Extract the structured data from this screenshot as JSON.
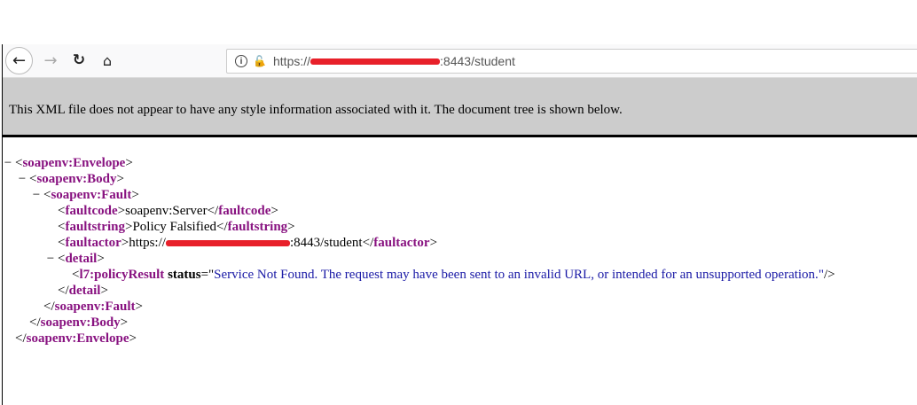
{
  "browser": {
    "url_prefix": "https://",
    "url_suffix": ":8443/student"
  },
  "banner": "This XML file does not appear to have any style information associated with it. The document tree is shown below.",
  "xml": {
    "envelope": "soapenv:Envelope",
    "body": "soapenv:Body",
    "fault": "soapenv:Fault",
    "faultcode_tag": "faultcode",
    "faultcode_value": "soapenv:Server",
    "faultstring_tag": "faultstring",
    "faultstring_value": "Policy Falsified",
    "faultactor_tag": "faultactor",
    "faultactor_prefix": "https://",
    "faultactor_suffix": ":8443/student",
    "detail": "detail",
    "policy_tag": "l7:policyResult",
    "policy_attr": "status",
    "policy_value": "Service Not Found. The request may have been sent to an invalid URL, or intended for an unsupported operation.",
    "collapse": "−"
  }
}
